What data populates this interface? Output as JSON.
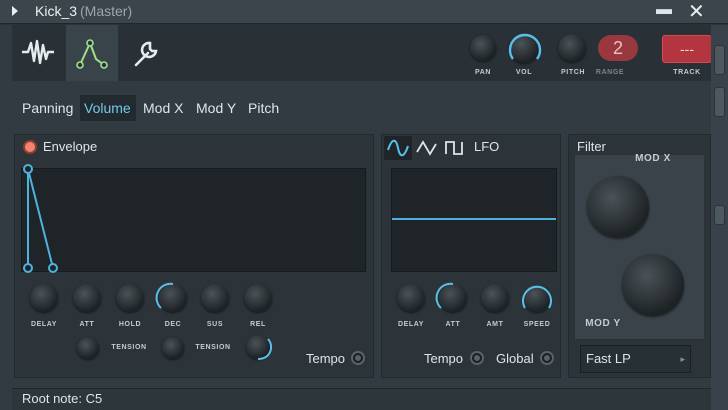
{
  "window": {
    "title": "Kick_3",
    "subtitle": "(Master)",
    "minimize": "▬",
    "close": "✕"
  },
  "toolbar": {
    "tabs": [
      {
        "icon": "waveform-icon"
      },
      {
        "icon": "envelope-icon"
      },
      {
        "icon": "wrench-icon"
      }
    ],
    "knobs": {
      "pan": "PAN",
      "vol": "VOL",
      "pitch": "PITCH",
      "range": "RANGE"
    },
    "range_value": "2",
    "track_value": "---",
    "track_label": "TRACK"
  },
  "subtabs": [
    "Panning",
    "Volume",
    "Mod X",
    "Mod Y",
    "Pitch"
  ],
  "active_subtab": "Volume",
  "envelope": {
    "title": "Envelope",
    "knobs": [
      "DELAY",
      "ATT",
      "HOLD",
      "DEC",
      "SUS",
      "REL"
    ],
    "tension1": "TENSION",
    "tension2": "TENSION",
    "tempo": "Tempo"
  },
  "lfo": {
    "title": "LFO",
    "knobs": [
      "DELAY",
      "ATT",
      "AMT",
      "SPEED"
    ],
    "tempo": "Tempo",
    "global": "Global"
  },
  "filter": {
    "title": "Filter",
    "mod_x": "MOD X",
    "mod_y": "MOD Y",
    "type": "Fast LP"
  },
  "status": {
    "root_note": "Root note: C5"
  },
  "colors": {
    "accent": "#58c0ea",
    "track": "#b2353f"
  }
}
